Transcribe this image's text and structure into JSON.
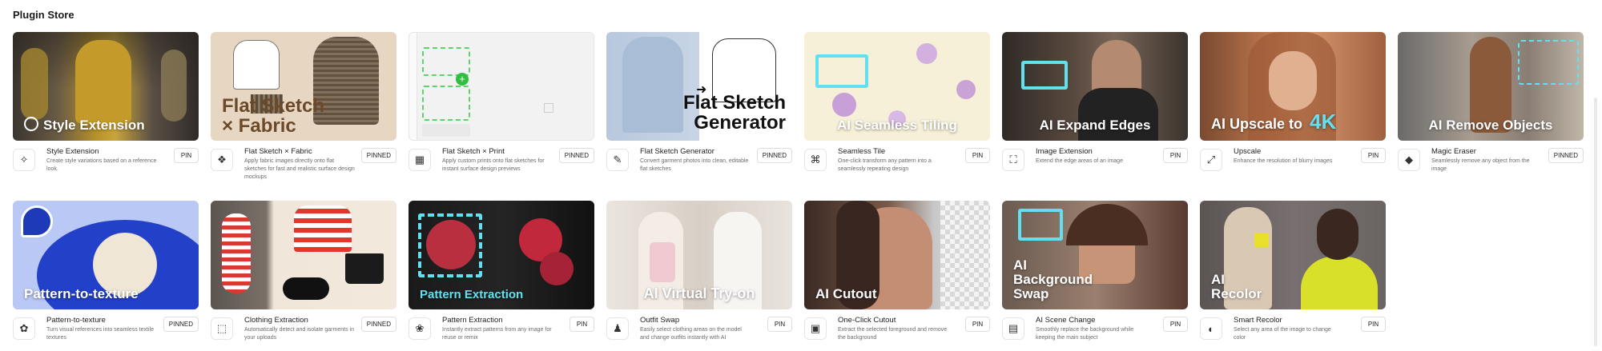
{
  "page": {
    "title": "Plugin Store"
  },
  "plugins": [
    {
      "title": "Style Extension",
      "thumb_label": "Style Extension",
      "description": "Create style variations based on a reference look.",
      "pin": "PIN",
      "icon": "style-icon"
    },
    {
      "title": "Flat Sketch × Fabric",
      "thumb_label": "Flat Sketch\n× Fabric",
      "description": "Apply fabric images directly onto flat sketches for fast and realistic surface design mockups",
      "pin": "PINNED",
      "icon": "fabric-icon"
    },
    {
      "title": "Flat Sketch × Print",
      "thumb_label": "",
      "description": "Apply custom prints onto flat sketches for instant surface design previews",
      "pin": "PINNED",
      "icon": "print-icon"
    },
    {
      "title": "Flat Sketch Generator",
      "thumb_label": "Flat Sketch\nGenerator",
      "description": "Convert garment photos into clean, editable flat sketches",
      "pin": "PINNED",
      "icon": "sketch-icon"
    },
    {
      "title": "Seamless Tile",
      "thumb_label": "AI Seamless Tiling",
      "description": "One-click transform any pattern into a seamlessly repeating design",
      "pin": "PIN",
      "icon": "tile-icon"
    },
    {
      "title": "Image Extension",
      "thumb_label": "AI Expand Edges",
      "description": "Extend the edge areas of an image",
      "pin": "PIN",
      "icon": "expand-icon"
    },
    {
      "title": "Upscale",
      "thumb_label": "AI Upscale to",
      "thumb_label_extra": "4K",
      "description": "Enhance the resolution of blurry images",
      "pin": "PIN",
      "icon": "upscale-icon"
    },
    {
      "title": "Magic Eraser",
      "thumb_label": "AI Remove Objects",
      "description": "Seamlessly remove any object from the image",
      "pin": "PINNED",
      "icon": "eraser-icon"
    },
    {
      "title": "Pattern-to-texture",
      "thumb_label": "Pattern-to-texture",
      "description": "Turn visual references into seamless textile textures",
      "pin": "PINNED",
      "icon": "texture-icon"
    },
    {
      "title": "Clothing Extraction",
      "thumb_label": "",
      "description": "Automatically detect and isolate garments in your uploads",
      "pin": "PINNED",
      "icon": "extract-icon"
    },
    {
      "title": "Pattern Extraction",
      "thumb_label": "Pattern Extraction",
      "description": "Instantly extract patterns from any image for reuse or remix",
      "pin": "PIN",
      "icon": "pattern-icon"
    },
    {
      "title": "Outfit Swap",
      "thumb_label": "AI Virtual Try-on",
      "description": "Easily select clothing areas on the model and change outfits instantly with AI",
      "pin": "PIN",
      "icon": "outfit-icon"
    },
    {
      "title": "One-Click Cutout",
      "thumb_label": "AI Cutout",
      "description": "Extract the selected foreground and remove the background",
      "pin": "PIN",
      "icon": "cutout-icon"
    },
    {
      "title": "AI Scene Change",
      "thumb_label": "AI\nBackground\nSwap",
      "description": "Smoothly replace the background while keeping the main subject",
      "pin": "PIN",
      "icon": "scene-icon"
    },
    {
      "title": "Smart Recolor",
      "thumb_label": "AI\nRecolor",
      "description": "Select any area of the image to change color",
      "pin": "PIN",
      "icon": "palette-icon"
    }
  ],
  "colors": {
    "accent": "#62e0f0",
    "pin_border": "#dedede"
  }
}
